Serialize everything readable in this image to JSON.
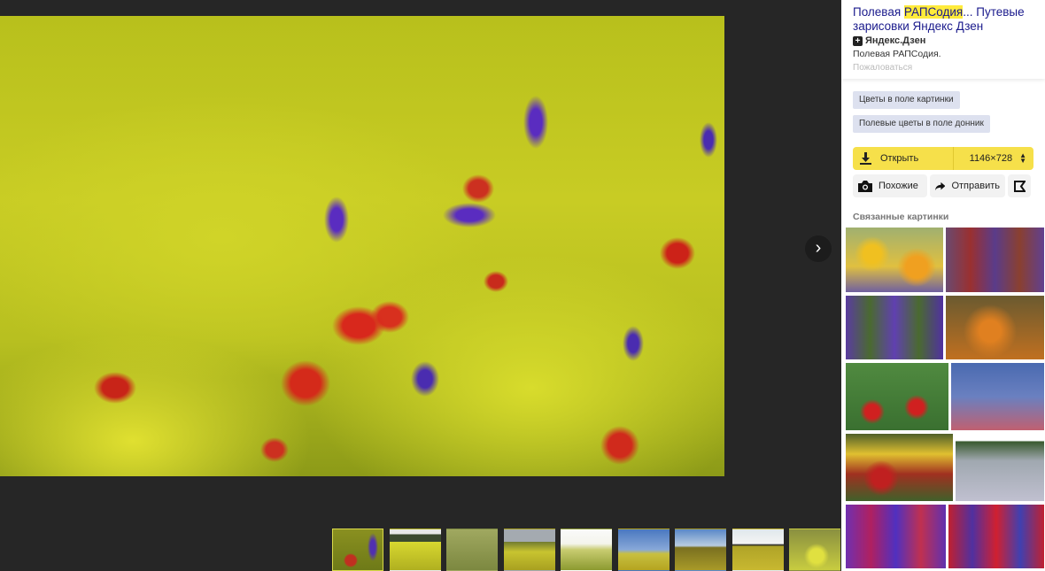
{
  "viewer": {
    "next_icon": "chevron-right-icon",
    "thumbnail_count": 9,
    "active_thumbnail": 0
  },
  "panel": {
    "title_prefix": "Полевая ",
    "title_highlight": "РАПСодия",
    "title_suffix": "... Путевые зарисовки Яндекс Дзен",
    "source": "Яндекс.Дзен",
    "description": "Полевая РАПСодия.",
    "report": "Пожаловаться",
    "tags": [
      "Цветы в поле картинки",
      "Полевые цветы в поле донник"
    ],
    "open_label": "Открыть",
    "size_label": "1146×728",
    "similar_label": "Похожие",
    "share_label": "Отправить",
    "related_title": "Связанные картинки"
  }
}
